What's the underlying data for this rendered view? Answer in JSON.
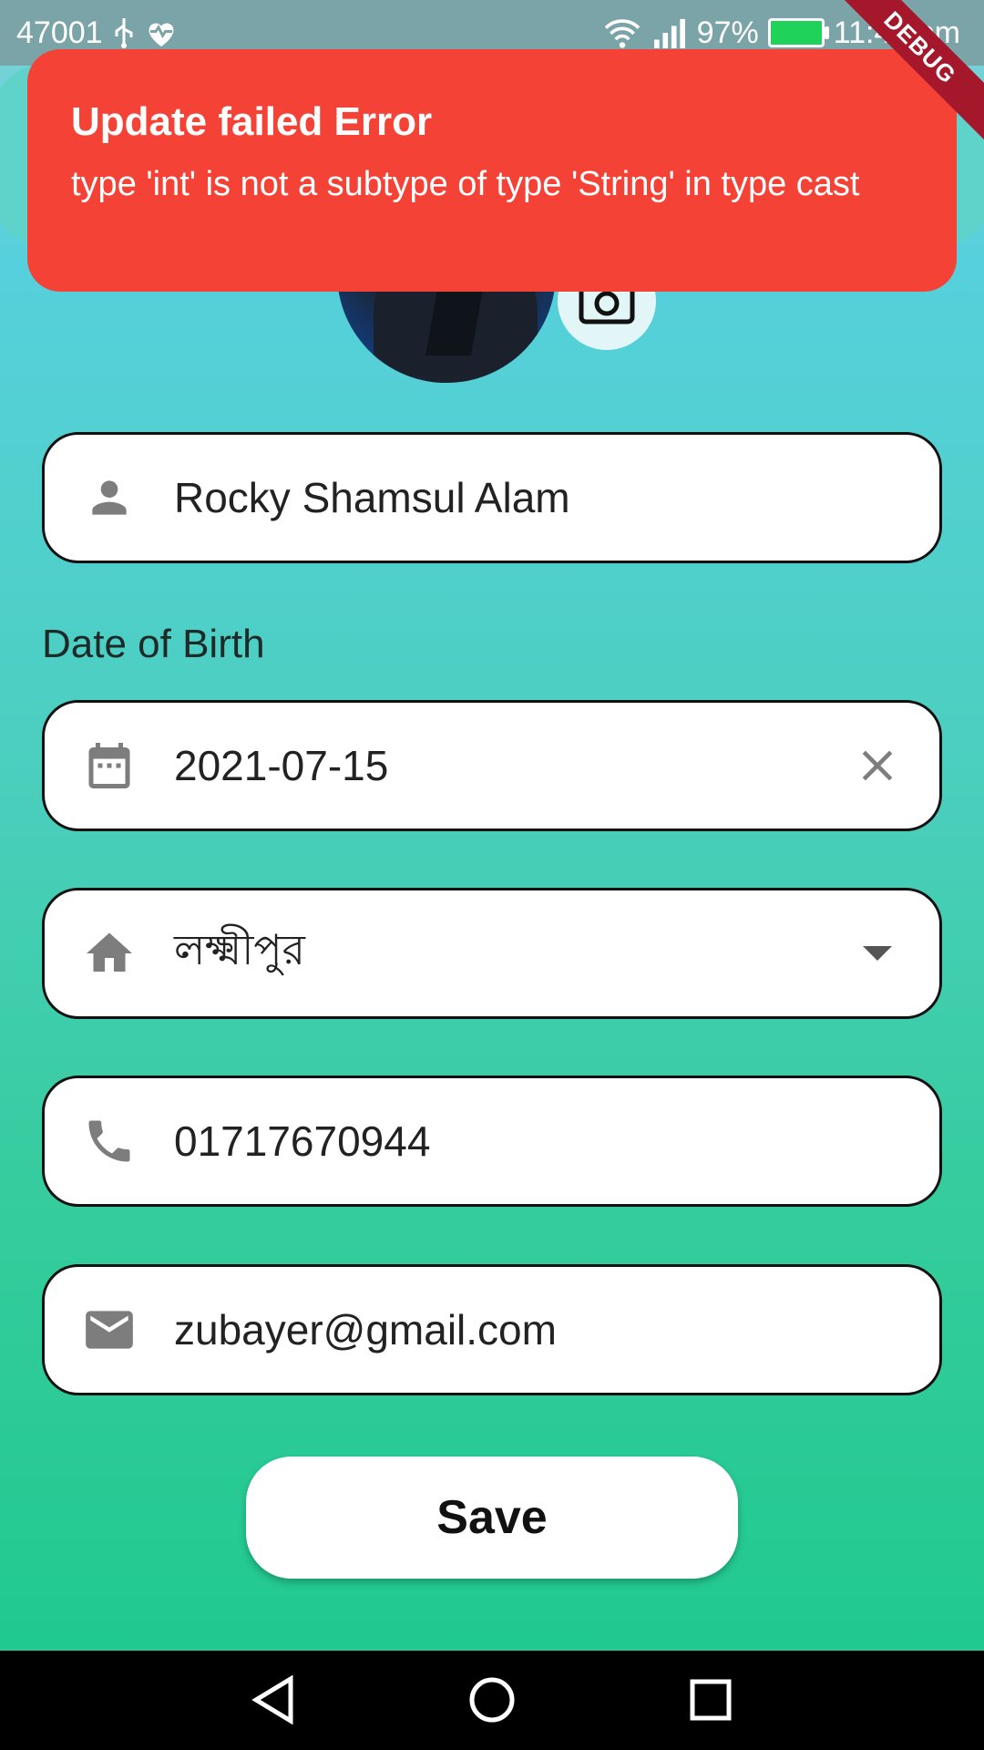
{
  "status_bar": {
    "left_text": "47001",
    "battery_percent": "97%",
    "time": "11:40 pm",
    "icons": [
      "usb-icon",
      "heart-pulse-icon",
      "wifi-icon",
      "signal-icon",
      "battery-charging-icon"
    ]
  },
  "debug_banner": "DEBUG",
  "snackbar": {
    "title": "Update failed Error",
    "message": "type 'int' is not a subtype of type 'String' in type cast",
    "color": "#f44336"
  },
  "profile": {
    "name": "Rocky Shamsul Alam",
    "dob_label": "Date of Birth",
    "dob": "2021-07-15",
    "district": "লক্ষ্মীপুর",
    "phone": "01717670944",
    "email": "zubayer@gmail.com"
  },
  "save_label": "Save",
  "colors": {
    "gradient_top": "#56d0dc",
    "gradient_bottom": "#20c98f",
    "icon_gray": "#7d7d7d"
  }
}
